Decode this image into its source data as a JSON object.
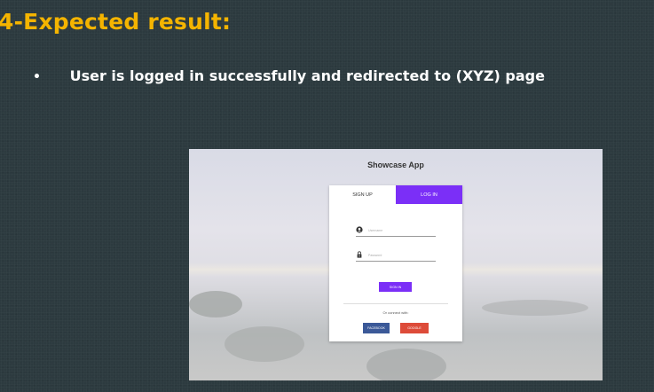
{
  "slide": {
    "title": "4-Expected result:",
    "bullet": "•",
    "bullet_text": "User is logged in successfully and redirected to (XYZ) page"
  },
  "app": {
    "title": "Showcase App",
    "tabs": [
      {
        "label": "SIGN UP",
        "active": false
      },
      {
        "label": "LOG IN",
        "active": true
      }
    ],
    "username_placeholder": "Username",
    "password_placeholder": "Password",
    "signin_label": "SIGN IN",
    "connect_text": "Or connect with:",
    "facebook_label": "FACEBOOK",
    "google_label": "GOOGLE"
  },
  "colors": {
    "title": "#f4b400",
    "accent": "#7b2ff7",
    "facebook": "#3b5998",
    "google": "#dd4b39"
  },
  "icons": {
    "username": "user-circle-icon",
    "password": "lock-icon"
  }
}
